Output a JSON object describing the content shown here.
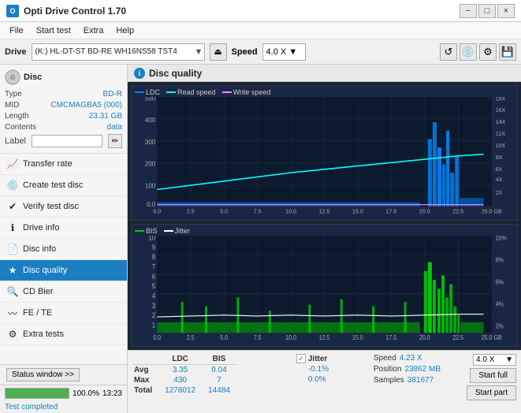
{
  "window": {
    "title": "Opti Drive Control 1.70",
    "controls": [
      "−",
      "□",
      "×"
    ]
  },
  "menu": {
    "items": [
      "File",
      "Start test",
      "Extra",
      "Help"
    ]
  },
  "drive_toolbar": {
    "drive_label": "Drive",
    "drive_value": "(K:)  HL-DT-ST BD-RE  WH16NS58 TST4",
    "speed_label": "Speed",
    "speed_value": "4.0 X"
  },
  "sidebar": {
    "disc_header": "Disc",
    "fields": [
      {
        "label": "Type",
        "value": "BD-R",
        "blue": true
      },
      {
        "label": "MID",
        "value": "CMCMAGBA5 (000)",
        "blue": true
      },
      {
        "label": "Length",
        "value": "23.31 GB",
        "blue": true
      },
      {
        "label": "Contents",
        "value": "data",
        "blue": true
      },
      {
        "label": "Label",
        "value": "",
        "input": true
      }
    ],
    "nav_items": [
      {
        "id": "transfer-rate",
        "icon": "📈",
        "label": "Transfer rate",
        "active": false
      },
      {
        "id": "create-test-disc",
        "icon": "💿",
        "label": "Create test disc",
        "active": false
      },
      {
        "id": "verify-test-disc",
        "icon": "✔",
        "label": "Verify test disc",
        "active": false
      },
      {
        "id": "drive-info",
        "icon": "ℹ",
        "label": "Drive info",
        "active": false
      },
      {
        "id": "disc-info",
        "icon": "📄",
        "label": "Disc info",
        "active": false
      },
      {
        "id": "disc-quality",
        "icon": "★",
        "label": "Disc quality",
        "active": true
      },
      {
        "id": "cd-bier",
        "icon": "🔍",
        "label": "CD Bier",
        "active": false
      },
      {
        "id": "fe-te",
        "icon": "〰",
        "label": "FE / TE",
        "active": false
      },
      {
        "id": "extra-tests",
        "icon": "⚙",
        "label": "Extra tests",
        "active": false
      }
    ],
    "status_btn": "Status window >>",
    "progress": 100,
    "status_text": "Test completed",
    "time": "13:23"
  },
  "disc_quality": {
    "title": "Disc quality",
    "legend_top": [
      "LDC",
      "Read speed",
      "Write speed"
    ],
    "legend_bottom": [
      "BIS",
      "Jitter"
    ],
    "legend_colors": {
      "LDC": "#0080ff",
      "Read_speed": "#00ffff",
      "Write_speed": "#ff44ff",
      "BIS": "#00cc00",
      "Jitter": "#ffffff"
    },
    "y_axis_top": [
      "500",
      "400",
      "300",
      "200",
      "100",
      "0.0"
    ],
    "y_axis_top_right": [
      "18X",
      "16X",
      "14X",
      "12X",
      "10X",
      "8X",
      "6X",
      "4X",
      "2X"
    ],
    "x_axis": [
      "0.0",
      "2.5",
      "5.0",
      "7.5",
      "10.0",
      "12.5",
      "15.0",
      "17.5",
      "20.0",
      "22.5",
      "25.0 GB"
    ],
    "y_axis_bottom": [
      "10",
      "9",
      "8",
      "7",
      "6",
      "5",
      "4",
      "3",
      "2",
      "1"
    ],
    "y_axis_bottom_right": [
      "10%",
      "8%",
      "6%",
      "4%",
      "2%"
    ]
  },
  "stats": {
    "columns": [
      "",
      "LDC",
      "BIS",
      "",
      "Jitter",
      "Speed",
      "4.23 X",
      ""
    ],
    "rows": [
      {
        "label": "Avg",
        "ldc": "3.35",
        "bis": "0.04",
        "jitter": "-0.1%"
      },
      {
        "label": "Max",
        "ldc": "430",
        "bis": "7",
        "jitter": "0.0%"
      },
      {
        "label": "Total",
        "ldc": "1278012",
        "bis": "14484",
        "jitter": ""
      }
    ],
    "speed_label": "Speed",
    "speed_value": "4.23 X",
    "speed_select": "4.0 X",
    "position_label": "Position",
    "position_value": "23862 MB",
    "samples_label": "Samples",
    "samples_value": "381677",
    "jitter_checked": true,
    "jitter_label": "Jitter",
    "btn_start_full": "Start full",
    "btn_start_part": "Start part"
  }
}
